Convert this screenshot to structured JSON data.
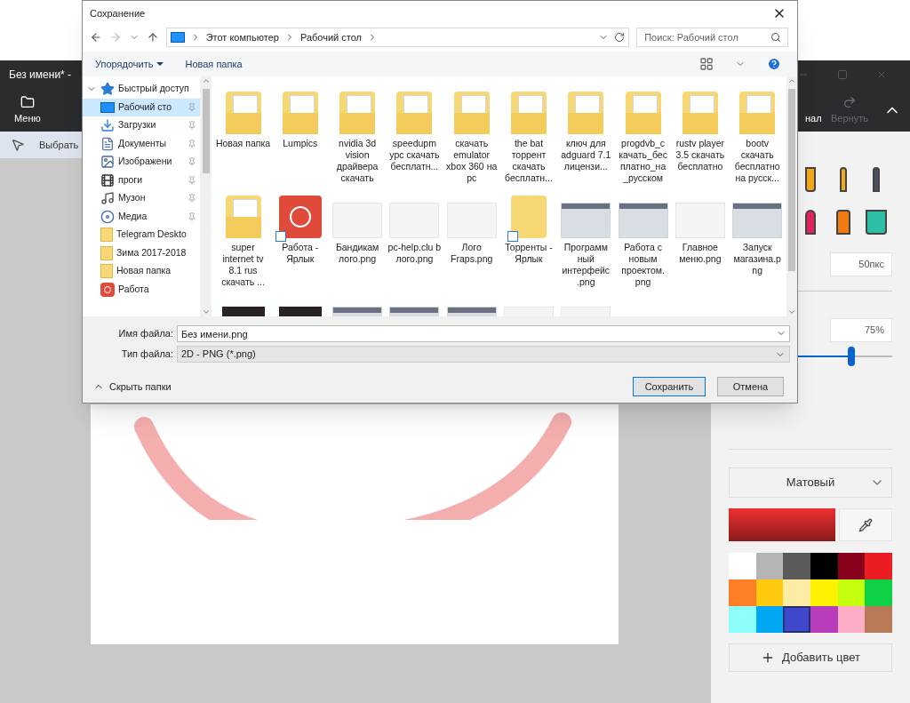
{
  "app": {
    "title": "Без имени* -",
    "toolbar": [
      {
        "kind": "menu",
        "label": "Меню"
      },
      {
        "kind": "history",
        "label": "нал"
      },
      {
        "kind": "redo",
        "label": "Вернуть",
        "disabled": true
      }
    ],
    "tool": {
      "label": "Выбрать"
    }
  },
  "dialog": {
    "title": "Сохранение",
    "breadcrumb": [
      "Этот компьютер",
      "Рабочий стол"
    ],
    "search": {
      "placeholder": "Поиск: Рабочий стол"
    },
    "commands": [
      {
        "label": "Упорядочить",
        "menu": true
      },
      {
        "label": "Новая папка",
        "menu": false
      }
    ],
    "nav": [
      {
        "kind": "star",
        "label": "Быстрый доступ",
        "pinned": false,
        "selected": false,
        "expanded": true
      },
      {
        "kind": "desktop",
        "label": "Рабочий сто",
        "pinned": true,
        "selected": true
      },
      {
        "kind": "download",
        "label": "Загрузки",
        "pinned": true,
        "selected": false
      },
      {
        "kind": "document",
        "label": "Документы",
        "pinned": true,
        "selected": false
      },
      {
        "kind": "picture",
        "label": "Изображени",
        "pinned": true,
        "selected": false
      },
      {
        "kind": "film",
        "label": "проги",
        "pinned": true,
        "selected": false
      },
      {
        "kind": "music",
        "label": "Музон",
        "pinned": true,
        "selected": false
      },
      {
        "kind": "media",
        "label": "Медиа",
        "pinned": true,
        "selected": false
      },
      {
        "kind": "folder",
        "label": "Telegram Deskto",
        "pinned": false,
        "selected": false
      },
      {
        "kind": "folder",
        "label": "Зима 2017-2018",
        "pinned": false,
        "selected": false
      },
      {
        "kind": "folder",
        "label": "Новая папка",
        "pinned": false,
        "selected": false
      },
      {
        "kind": "app",
        "label": "Работа",
        "pinned": false,
        "selected": false
      }
    ],
    "files": [
      {
        "kind": "folder",
        "label": "Новая папка"
      },
      {
        "kind": "folder",
        "label": "Lumpics"
      },
      {
        "kind": "folder",
        "label": "nvidia 3d vision драйвера скачать"
      },
      {
        "kind": "folder",
        "label": "speedupm ypc скачать бесплатн..."
      },
      {
        "kind": "folder",
        "label": "скачать emulator xbox 360 на pc"
      },
      {
        "kind": "folder",
        "label": "the bat торрент скачать бесплатн..."
      },
      {
        "kind": "folder",
        "label": "ключ для adguard 7.1 лицензи..."
      },
      {
        "kind": "folder",
        "label": "progdvb_c качать_бес платно_на _русском"
      },
      {
        "kind": "folder",
        "label": "rustv player 3.5 скачать бесплатно"
      },
      {
        "kind": "folder",
        "label": "bootv скачать бесплатно на русск..."
      },
      {
        "kind": "folder",
        "label": "super internet tv 8.1 rus скачать ..."
      },
      {
        "kind": "app-shortcut",
        "label": "Работа - Ярлык"
      },
      {
        "kind": "image",
        "label": "Бандикам лого.png"
      },
      {
        "kind": "image",
        "label": "pc-help.clu b лого.png"
      },
      {
        "kind": "image",
        "label": "Лого Fraps.png"
      },
      {
        "kind": "folder-shortcut",
        "label": "Торренты - Ярлык"
      },
      {
        "kind": "screenshot",
        "label": "Программ ный интерфейс .png"
      },
      {
        "kind": "screenshot",
        "label": "Работа с новым проектом. png"
      },
      {
        "kind": "image",
        "label": "Главное меню.png"
      },
      {
        "kind": "screenshot",
        "label": "Запуск магазина.p ng"
      },
      {
        "kind": "dark-photo"
      },
      {
        "kind": "dark-photo"
      },
      {
        "kind": "screenshot"
      },
      {
        "kind": "screenshot"
      },
      {
        "kind": "screenshot"
      },
      {
        "kind": "image"
      },
      {
        "kind": "image"
      }
    ],
    "filename": {
      "label": "Имя файла:",
      "value": "Без имени.png"
    },
    "filetype": {
      "label": "Тип файла:",
      "value": "2D - PNG (*.png)"
    },
    "hide_folders": "Скрыть папки",
    "buttons": [
      {
        "label": "Сохранить",
        "primary": true
      },
      {
        "label": "Отмена",
        "primary": false
      }
    ]
  },
  "panel": {
    "tools": [
      {
        "kind": "marker",
        "color": "#f2a81d"
      },
      {
        "kind": "brush",
        "color": "#f2a81d"
      },
      {
        "kind": "pen",
        "color": "#4a5060"
      },
      {
        "kind": "crayon",
        "color": "#e0245e"
      },
      {
        "kind": "spray",
        "color": "#f07a10"
      },
      {
        "kind": "bucket",
        "color": "#2bbfa5"
      }
    ],
    "thickness": {
      "value": "50пкс"
    },
    "opacity": {
      "value": "75%",
      "level": 0.75
    },
    "texture": "Матовый",
    "palette": [
      {
        "color": "#ffffff",
        "selected": false
      },
      {
        "color": "#b4b4b4",
        "selected": false
      },
      {
        "color": "#5a5a5a",
        "selected": false
      },
      {
        "color": "#000000",
        "selected": false
      },
      {
        "color": "#88001b",
        "selected": false
      },
      {
        "color": "#ec1c24",
        "selected": false
      },
      {
        "color": "#ff7f27",
        "selected": false
      },
      {
        "color": "#ffc90e",
        "selected": false
      },
      {
        "color": "#fdeca6",
        "selected": false
      },
      {
        "color": "#fff200",
        "selected": false
      },
      {
        "color": "#c4ff0e",
        "selected": false
      },
      {
        "color": "#0ed145",
        "selected": false
      },
      {
        "color": "#8cfffb",
        "selected": false
      },
      {
        "color": "#00a8f3",
        "selected": false
      },
      {
        "color": "#3f48cc",
        "selected": true
      },
      {
        "color": "#b83dba",
        "selected": false
      },
      {
        "color": "#ffaec8",
        "selected": false
      },
      {
        "color": "#b97a57",
        "selected": false
      }
    ],
    "add_color": "Добавить цвет"
  }
}
